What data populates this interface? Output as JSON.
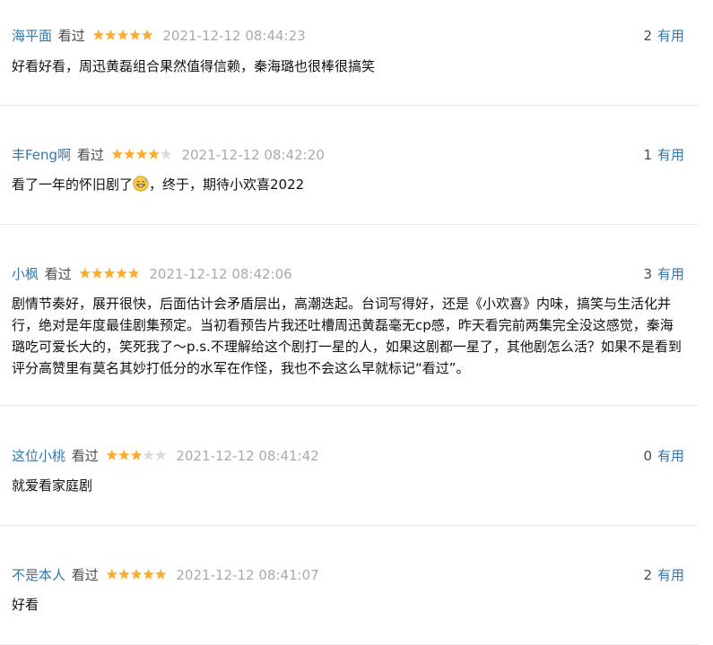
{
  "reviews": [
    {
      "user": "海平面",
      "status": "看过",
      "rating": 5,
      "time": "2021-12-12 08:44:23",
      "votes": "2",
      "useful_label": "有用",
      "content": "好看好看，周迅黄磊组合果然值得信赖，秦海璐也很棒很搞笑"
    },
    {
      "user": "丰Feng啊",
      "status": "看过",
      "rating": 4,
      "time": "2021-12-12 08:42:20",
      "votes": "1",
      "useful_label": "有用",
      "content_before_emoji": "看了一年的怀旧剧了",
      "emoji": "grinning-sweat-emoji",
      "content_after_emoji": "，终于，期待小欢喜2022"
    },
    {
      "user": "小枫",
      "status": "看过",
      "rating": 5,
      "time": "2021-12-12 08:42:06",
      "votes": "3",
      "useful_label": "有用",
      "content": "剧情节奏好，展开很快，后面估计会矛盾层出，高潮迭起。台词写得好，还是《小欢喜》内味，搞笑与生活化并行，绝对是年度最佳剧集预定。当初看预告片我还吐槽周迅黄磊毫无cp感，昨天看完前两集完全没这感觉，秦海璐吃可爱长大的，笑死我了～p.s.不理解给这个剧打一星的人，如果这剧都一星了，其他剧怎么活？如果不是看到评分高赞里有莫名其妙打低分的水军在作怪，我也不会这么早就标记“看过”。"
    },
    {
      "user": "这位小桃",
      "status": "看过",
      "rating": 3,
      "time": "2021-12-12 08:41:42",
      "votes": "0",
      "useful_label": "有用",
      "content": "就爱看家庭剧"
    },
    {
      "user": "不是本人",
      "status": "看过",
      "rating": 5,
      "time": "2021-12-12 08:41:07",
      "votes": "2",
      "useful_label": "有用",
      "content": "好看"
    }
  ],
  "colors": {
    "link": "#3377aa",
    "star_on": "#ffac2d",
    "star_off": "#dcdcdc",
    "time": "#aaaaaa",
    "divider": "#eaeaea"
  }
}
